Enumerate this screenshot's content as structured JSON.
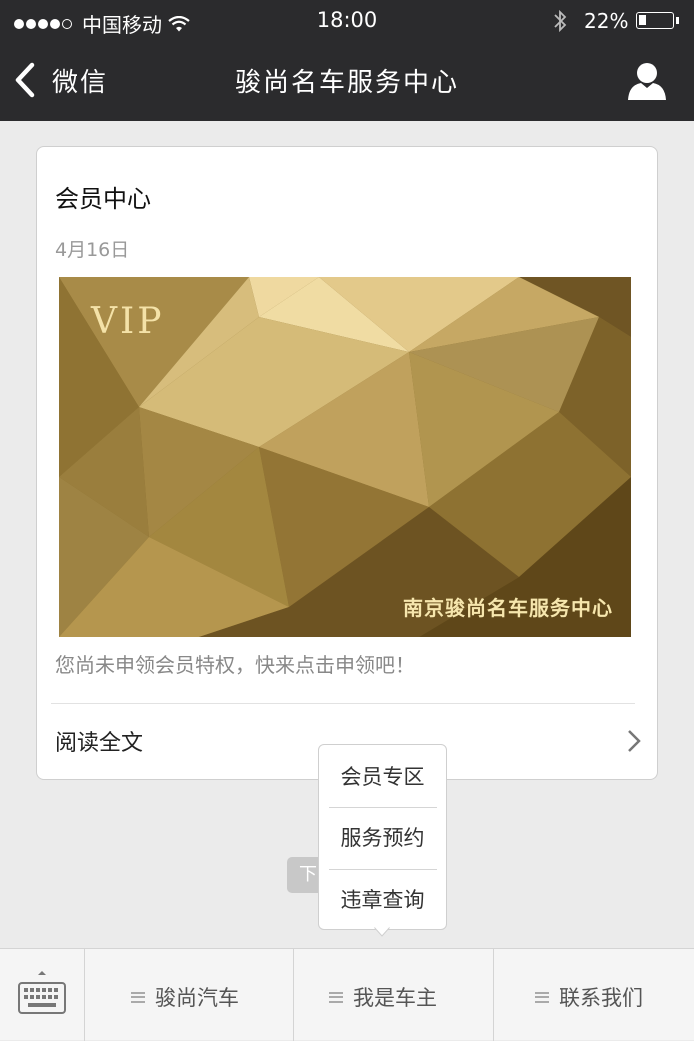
{
  "status_bar": {
    "carrier": "中国移动",
    "time": "18:00",
    "battery_percent": "22%",
    "battery_level": 0.22,
    "signal_bars": 4,
    "icons": [
      "signal-icon",
      "wifi-icon",
      "bluetooth-icon",
      "battery-icon"
    ]
  },
  "nav": {
    "back_label": "微信",
    "title": "骏尚名车服务中心",
    "icons": [
      "back-chevron-icon",
      "profile-icon"
    ]
  },
  "article_card": {
    "title": "会员中心",
    "date": "4月16日",
    "image_vip_text": "VIP",
    "image_caption": "南京骏尚名车服务中心",
    "description": "您尚未申领会员特权，快来点击申领吧！",
    "read_more": "阅读全文"
  },
  "behind_hint": "下",
  "popup_menu": {
    "items": [
      "会员专区",
      "服务预约",
      "违章查询"
    ]
  },
  "bottom_menu": {
    "keyboard_icon": "keyboard-icon",
    "items": [
      "骏尚汽车",
      "我是车主",
      "联系我们"
    ]
  },
  "colors": {
    "nav_background": "#2b2b2d",
    "page_background": "#ebebeb",
    "gold": "#b89a4e"
  }
}
